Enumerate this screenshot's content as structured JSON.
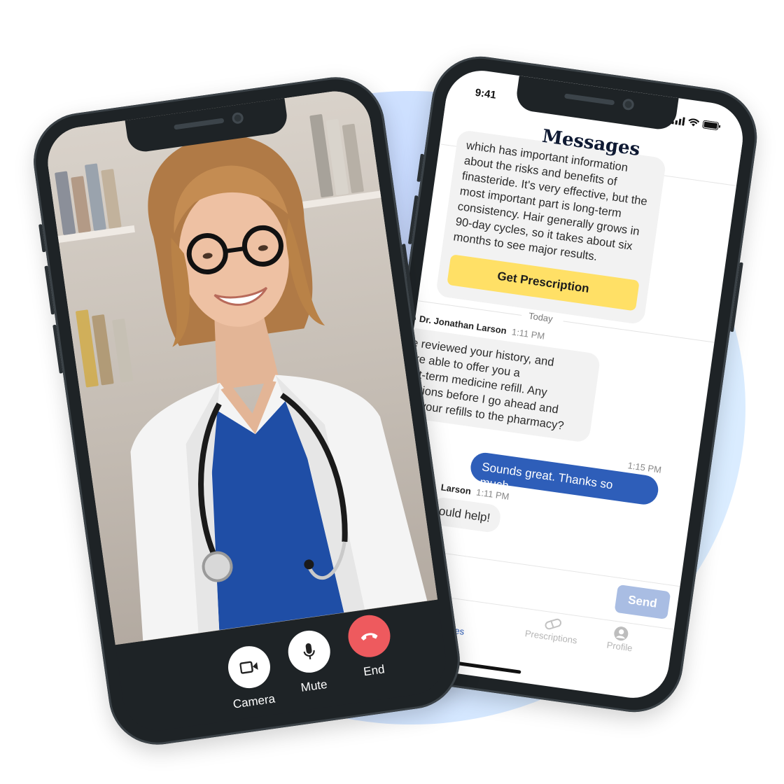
{
  "video_call": {
    "controls": [
      {
        "id": "camera",
        "label": "Camera",
        "icon": "video-camera-icon"
      },
      {
        "id": "mute",
        "label": "Mute",
        "icon": "microphone-icon"
      },
      {
        "id": "end",
        "label": "End",
        "icon": "phone-hangup-icon"
      }
    ]
  },
  "messages": {
    "status_time": "9:41",
    "title": "Messages",
    "earlier_message": "which has important information about the risks and benefits of finasteride. It's very effective, but the most important part is long-term consistency. Hair generally grows in 90-day cycles, so it takes about six months to see major results.",
    "cta_label": "Get Prescription",
    "day_divider": "Today",
    "thread": [
      {
        "sender": "Dr. Jonathan Larson",
        "time": "1:11 PM",
        "text": "I've reviewed your history, and we're able to offer you a short-term medicine refill. Any questions before I go ahead and send your refills to the pharmacy?"
      },
      {
        "sender": "me",
        "time": "1:15 PM",
        "text": "Sounds great. Thanks so much."
      },
      {
        "sender": "Dr. Jonathan Larson",
        "time": "1:11 PM",
        "text": "Glad I could help!"
      }
    ],
    "sender_visible": [
      "Dr. Jonathan Larson",
      "Larson"
    ],
    "visible_bubble_1": [
      "I've reviewed your history, and",
      "we're able to offer you a",
      "short-term medicine refill. Any",
      "questions before I go ahead and",
      "send your refills to the pharmacy?"
    ],
    "visible_bubble_3": "ould help!",
    "send_label": "Send",
    "tabs": [
      {
        "label": "Messages",
        "visible": "es",
        "icon": "chat-icon"
      },
      {
        "label": "Prescriptions",
        "visible": "Prescriptions",
        "icon": "pill-icon"
      },
      {
        "label": "Profile",
        "visible": "Profile",
        "icon": "profile-icon"
      }
    ]
  },
  "colors": {
    "accent_blue": "#2e5eb9",
    "send_button_disabled": "#a9bde3",
    "cta_yellow": "#ffe066",
    "end_call_red": "#ee5a5e",
    "background_blob": "#c9dbff"
  }
}
